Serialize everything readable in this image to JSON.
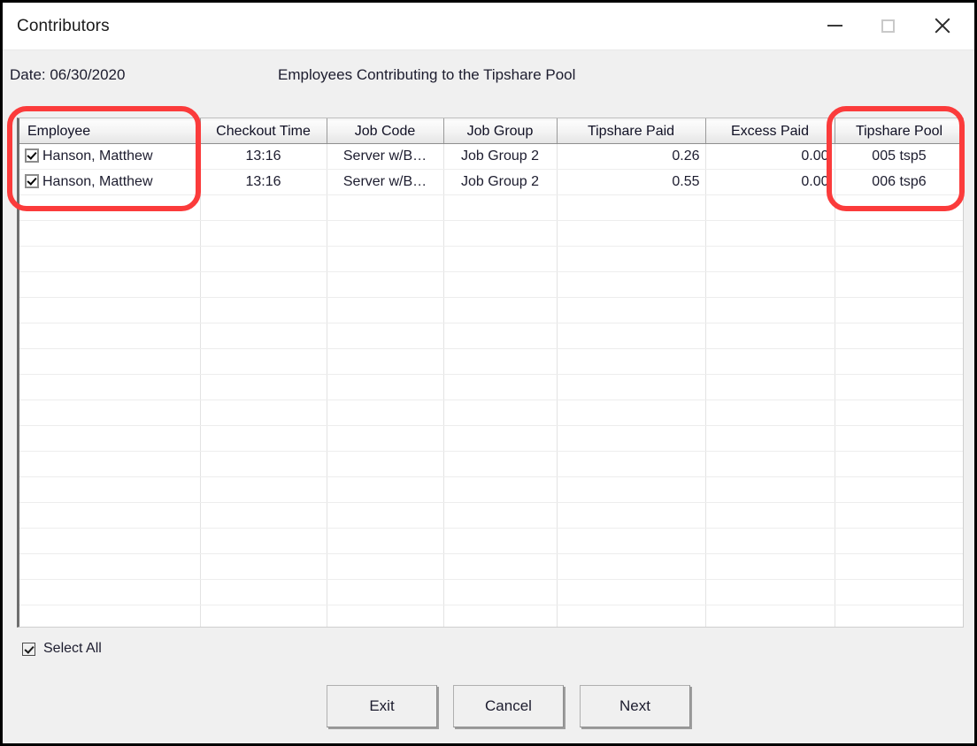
{
  "window": {
    "title": "Contributors",
    "controls": {
      "minimize": "–",
      "maximize": "□",
      "close": "✕"
    }
  },
  "info": {
    "date_label": "Date: 06/30/2020",
    "headline": "Employees Contributing to the Tipshare Pool"
  },
  "grid": {
    "columns": [
      "Employee",
      "Checkout Time",
      "Job Code",
      "Job Group",
      "Tipshare Paid",
      "Excess Paid",
      "Tipshare Pool"
    ],
    "rows": [
      {
        "selected": true,
        "employee": "Hanson, Matthew",
        "checkout_time": "13:16",
        "job_code": "Server w/B…",
        "job_group": "Job Group 2",
        "tipshare_paid": "0.26",
        "excess_paid": "0.00",
        "tipshare_pool": "005 tsp5"
      },
      {
        "selected": true,
        "employee": "Hanson, Matthew",
        "checkout_time": "13:16",
        "job_code": "Server w/B…",
        "job_group": "Job Group 2",
        "tipshare_paid": "0.55",
        "excess_paid": "0.00",
        "tipshare_pool": "006 tsp6"
      }
    ],
    "empty_row_count": 18
  },
  "select_all": {
    "label": "Select All",
    "checked": true
  },
  "buttons": {
    "exit": "Exit",
    "cancel": "Cancel",
    "next": "Next"
  },
  "annotations": {
    "color": "#fb3b3b",
    "highlighted_columns": [
      "Employee",
      "Tipshare Pool"
    ]
  }
}
